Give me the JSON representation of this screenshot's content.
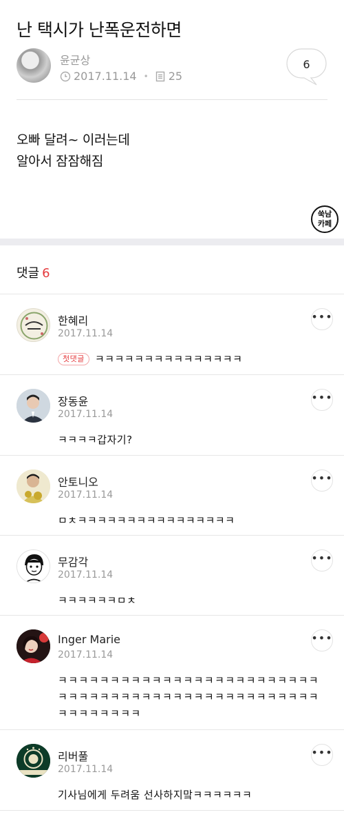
{
  "post": {
    "title": "난 택시가 난폭운전하면",
    "author": "윤균상",
    "date": "2017.11.14",
    "views": "25",
    "comment_count": "6",
    "body_lines": [
      "오빠 달려~ 이러는데",
      "알아서 잠잠해짐"
    ],
    "cafe_badge": [
      "쑥남",
      "카페"
    ]
  },
  "comments_section": {
    "label": "댓글",
    "count": "6",
    "first_comment_tag": "첫댓글",
    "items": [
      {
        "name": "한혜리",
        "date": "2017.11.14",
        "text": "ㅋㅋㅋㅋㅋㅋㅋㅋㅋㅋㅋㅋㅋㅋㅋ"
      },
      {
        "name": "장동윤",
        "date": "2017.11.14",
        "text": "ㅋㅋㅋㅋ갑자기?"
      },
      {
        "name": "안토니오",
        "date": "2017.11.14",
        "text": "ㅁㅊㅋㅋㅋㅋㅋㅋㅋㅋㅋㅋㅋㅋㅋㅋㅋㅋ"
      },
      {
        "name": "무감각",
        "date": "2017.11.14",
        "text": "ㅋㅋㅋㅋㅋㅋㅁㅊ"
      },
      {
        "name": "Inger Marie",
        "date": "2017.11.14",
        "text": "ㅋㅋㅋㅋㅋㅋㅋㅋㅋㅋㅋㅋㅋㅋㅋㅋㅋㅋㅋㅋㅋㅋㅋㅋㅋㅋㅋㅋㅋㅋㅋㅋㅋㅋㅋㅋㅋㅋㅋㅋㅋㅋㅋㅋㅋㅋㅋㅋㅋㅋㅋㅋㅋㅋㅋㅋㅋㅋ"
      },
      {
        "name": "리버풀",
        "date": "2017.11.14",
        "text": "기사님에게 두려움 선사하지�textㅋㅋㅋㅋㅋㅋ"
      }
    ]
  },
  "colors": {
    "accent": "#e5393c",
    "muted": "#999999",
    "divider": "#e6e6e6"
  }
}
